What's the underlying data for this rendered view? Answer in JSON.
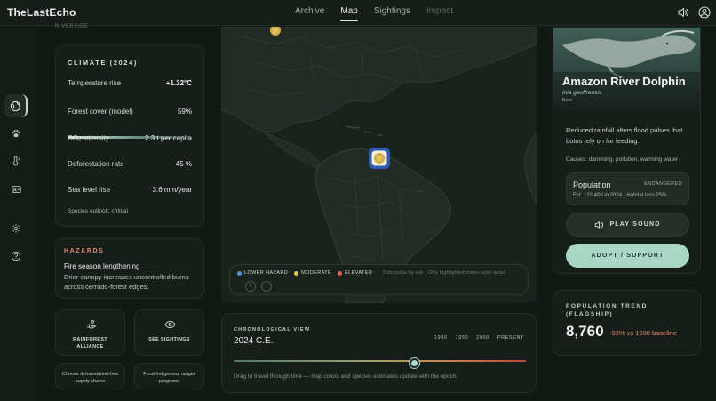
{
  "app": {
    "title": "TheLastEcho"
  },
  "nav": {
    "items": [
      {
        "label": "Archive",
        "state": "normal"
      },
      {
        "label": "Map",
        "state": "active"
      },
      {
        "label": "Sightings",
        "state": "normal"
      },
      {
        "label": "Impact",
        "state": "disabled"
      }
    ]
  },
  "topbar": {
    "icons": [
      "sound-icon",
      "account-icon"
    ]
  },
  "rail": {
    "icons": [
      "globe-icon",
      "paw-icon",
      "thermometer-icon",
      "species-icon",
      "settings-icon",
      "help-icon"
    ],
    "active": "globe-icon"
  },
  "region": {
    "kicker": "RIVERSIDE"
  },
  "climate": {
    "title": "CLIMATE (2024)",
    "rows": [
      {
        "label": "Temperature rise",
        "value": "+1.32°C"
      },
      {
        "label": "Forest cover (model)",
        "value": "59%"
      },
      {
        "label": "CO₂ intensity",
        "value": "2.3 t per capita"
      },
      {
        "label": "Deforestation rate",
        "value": "45 %"
      },
      {
        "label": "Sea level rise",
        "value": "3.6 mm/year"
      }
    ],
    "outlook": "Species outlook: critical"
  },
  "hazards": {
    "title": "HAZARDS",
    "headline": "Fire season lengthening",
    "detail": "Drier canopy increases uncontrolled burns across cerrado-forest edges."
  },
  "actions": {
    "tiles": [
      {
        "label": "RAINFOREST ALLIANCE",
        "icon": "handshake-icon"
      },
      {
        "label": "SEE SIGHTINGS",
        "icon": "eye-icon"
      }
    ],
    "subtiles": [
      {
        "label": "Choose deforestation-free supply chains"
      },
      {
        "label": "Fund Indigenous ranger programs"
      }
    ]
  },
  "map": {
    "legend": [
      {
        "label": "LOWER HAZARD",
        "color": "#5b8fd6"
      },
      {
        "label": "MODERATE",
        "color": "#e2c45a"
      },
      {
        "label": "ELEVATED",
        "color": "#d9604c"
      }
    ],
    "note": "Dots pulse by risk · Only highlighted states open detail",
    "zoom_in": "+",
    "zoom_out": "−"
  },
  "chrono": {
    "title": "CHRONOLOGICAL VIEW",
    "era": "2024 C.E.",
    "ticks": [
      "1900",
      "1950",
      "2000",
      "PRESENT"
    ],
    "position": 0.62,
    "help": "Drag to travel through time — map colors and species estimates update with the epoch."
  },
  "species": {
    "name": "Amazon River Dolphin",
    "latin": "Inia geoffrensis",
    "local": "Boto",
    "description": "Reduced rainfall alters flood pulses that botos rely on for feeding.",
    "causes": "Causes: damming, pollution, warming water",
    "population": {
      "title": "Population",
      "status": "ENDANGERED",
      "estimate": "Est. 122,400 in 2024 · Habitat loss 25%"
    },
    "play_label": "PLAY SOUND",
    "adopt_label": "ADOPT / SUPPORT"
  },
  "trend": {
    "title": "POPULATION TREND (FLAGSHIP)",
    "value": "8,760",
    "delta": "-93% vs 1900 baseline"
  }
}
